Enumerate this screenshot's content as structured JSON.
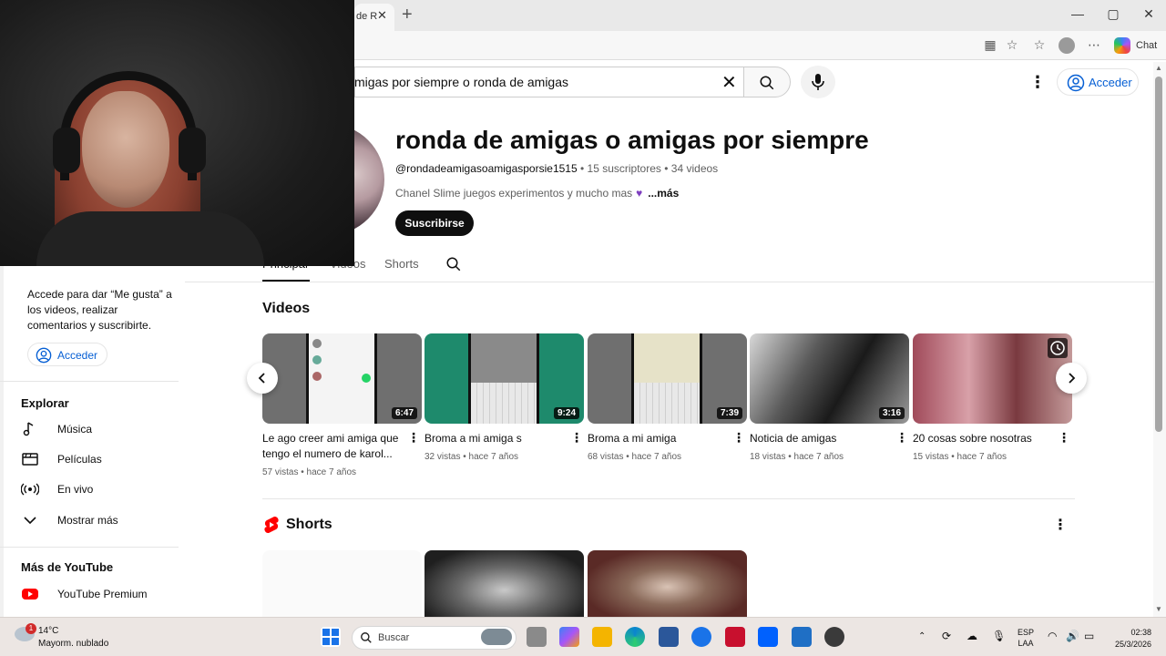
{
  "browser": {
    "tab_label": "de R",
    "chat_label": "Chat"
  },
  "header": {
    "search_query": "migas por siempre o ronda de amigas",
    "signin_label": "Acceder"
  },
  "channel": {
    "title": "ronda de amigas o amigas por siempre",
    "handle": "@rondadeamigasoamigasporsie1515",
    "subscribers": "15 suscriptores",
    "videos_count": "34 videos",
    "description": "Chanel Slime juegos experimentos y mucho mas",
    "more_label": "...más",
    "subscribe_label": "Suscribirse",
    "tabs": [
      {
        "label": "Principal"
      },
      {
        "label": "Videos"
      },
      {
        "label": "Shorts"
      }
    ]
  },
  "sidebar": {
    "note": "Accede para dar “Me gusta” a los videos, realizar comentarios y suscribirte.",
    "signin_label": "Acceder",
    "explore_heading": "Explorar",
    "explore_items": [
      {
        "label": "Música",
        "icon": "music-icon"
      },
      {
        "label": "Películas",
        "icon": "clapperboard-icon"
      },
      {
        "label": "En vivo",
        "icon": "live-icon"
      },
      {
        "label": "Mostrar más",
        "icon": "chevron-down-icon"
      }
    ],
    "more_heading": "Más de YouTube",
    "more_items": [
      {
        "label": "YouTube Premium",
        "icon": "youtube-logo-icon"
      }
    ]
  },
  "videos_section": {
    "title": "Videos",
    "videos": [
      {
        "title": "Le ago creer ami amiga que tengo el numero de karol...",
        "duration": "6:47",
        "meta": "57 vistas • hace 7 años"
      },
      {
        "title": "Broma a mi amiga s",
        "duration": "9:24",
        "meta": "32 vistas • hace 7 años"
      },
      {
        "title": "Broma a mi amiga",
        "duration": "7:39",
        "meta": "68 vistas • hace 7 años"
      },
      {
        "title": "Noticia de amigas",
        "duration": "3:16",
        "meta": "18 vistas • hace 7 años"
      },
      {
        "title": "20 cosas sobre nosotras",
        "duration": "",
        "meta": "15 vistas • hace 7 años"
      }
    ]
  },
  "shorts_section": {
    "title": "Shorts"
  },
  "taskbar": {
    "weather_badge": "1",
    "temperature": "14°C",
    "condition": "Mayorm. nublado",
    "search_placeholder": "Buscar",
    "lang_line1": "ESP",
    "lang_line2": "LAA",
    "time": "02:38",
    "date": "25/3/2026"
  },
  "colors": {
    "link_blue": "#065fd4",
    "youtube_red": "#ff0000",
    "text_primary": "#0f0f0f",
    "text_secondary": "#606060"
  }
}
